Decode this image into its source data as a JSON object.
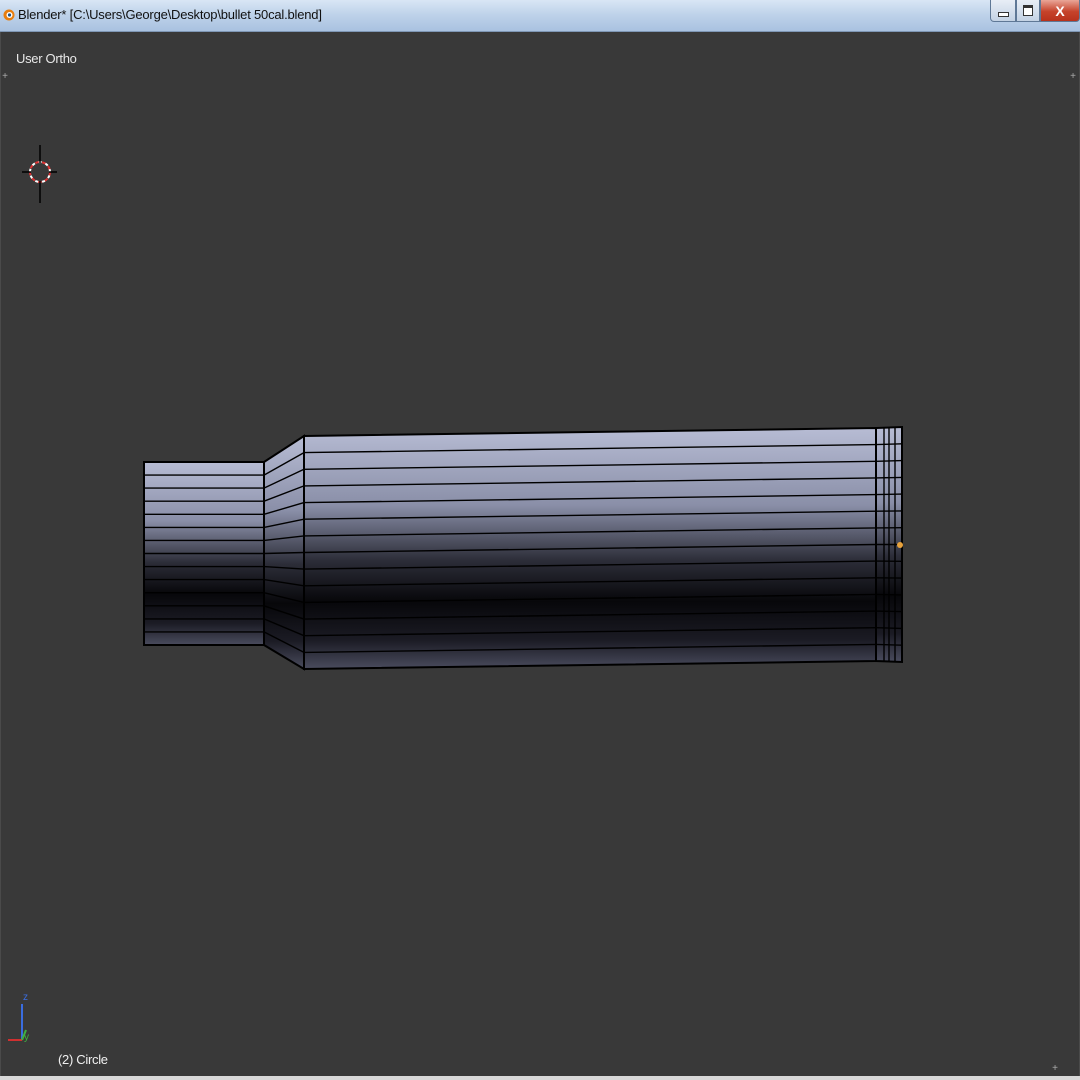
{
  "window": {
    "title": "Blender* [C:\\Users\\George\\Desktop\\bullet 50cal.blend]",
    "close_label": "X"
  },
  "viewport": {
    "view_label": "User Ortho",
    "object_label": "(2) Circle",
    "axis_z": "z",
    "axis_y": "y"
  },
  "colors": {
    "viewport_bg": "#393939",
    "mesh_light": "#aab0c8",
    "mesh_dark": "#050508",
    "wire": "#000000",
    "origin_dot": "#e8a23c"
  },
  "icons": [
    "blender-logo-icon",
    "minimize-icon",
    "maximize-icon",
    "close-icon",
    "3d-cursor-icon",
    "axis-gizmo-icon"
  ]
}
